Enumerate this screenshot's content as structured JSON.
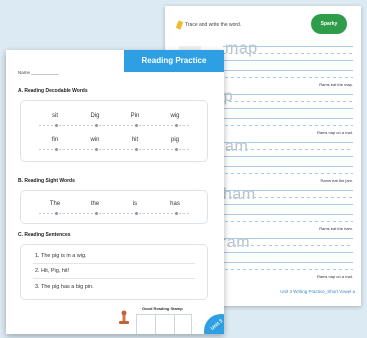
{
  "writing_sheet": {
    "instruction": "Trace and write the word.",
    "brand": "Sparky",
    "words": [
      {
        "word": "map",
        "sentence": "Rams eat the map."
      },
      {
        "word": "nap",
        "sentence": "Rams nap on a mat."
      },
      {
        "word": "jam",
        "sentence": "Rams eat the jam."
      },
      {
        "word": "ham",
        "sentence": "Rams eat the ham."
      },
      {
        "word": "ram",
        "sentence": "Rams nap on a mat."
      }
    ],
    "footer": "Unit 3 Writing Practice_Short Vowel a"
  },
  "reading_sheet": {
    "title": "Reading Practice",
    "name_label": "Name ___________",
    "section_a": {
      "title": "A. Reading Decodable Words",
      "row1": [
        "sit",
        "Dig",
        "Pin",
        "wig"
      ],
      "row2": [
        "fin",
        "win",
        "hit",
        "pig"
      ]
    },
    "section_b": {
      "title": "B. Reading Sight Words",
      "words": [
        "The",
        "the",
        "is",
        "has"
      ]
    },
    "section_c": {
      "title": "C. Reading Sentences",
      "sentences": [
        "1.  The pig is in a wig.",
        "2.  Hit, Pig, hit!",
        "3.  The pig has a big pin."
      ]
    },
    "stamp_label": "Good Reading Stamp",
    "corner_label": "Unit 3"
  }
}
